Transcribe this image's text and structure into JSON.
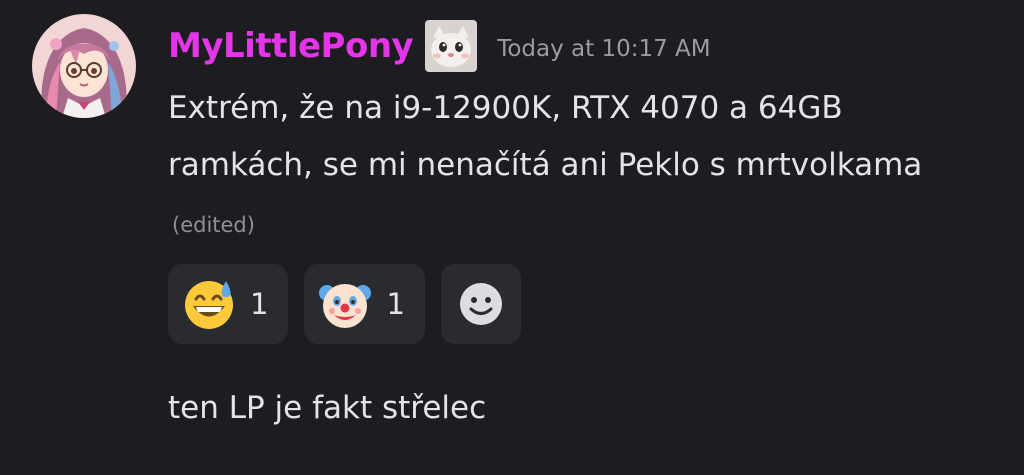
{
  "message": {
    "author": "MyLittlePony",
    "author_color": "#e535e8",
    "avatar_icon": "anime-girl-avatar",
    "role_icon": "cat-face-icon",
    "timestamp": "Today at 10:17 AM",
    "text": "Extrém, že na i9-12900K, RTX 4070 a 64GB ramkách, se mi nenačítá ani Peklo s mrtvolkama",
    "edited_label": "(edited)",
    "reactions": [
      {
        "emoji": "grinning-face-with-sweat-icon",
        "count": "1"
      },
      {
        "emoji": "clown-face-icon",
        "count": "1"
      }
    ],
    "add_reaction_icon": "add-reaction-smiley-icon"
  },
  "followup": {
    "text": "ten LP je fakt střelec"
  },
  "colors": {
    "background": "#1c1c21",
    "reaction_background": "#2a2b31",
    "text": "#e3e3e8",
    "muted": "#9a9ba3"
  }
}
